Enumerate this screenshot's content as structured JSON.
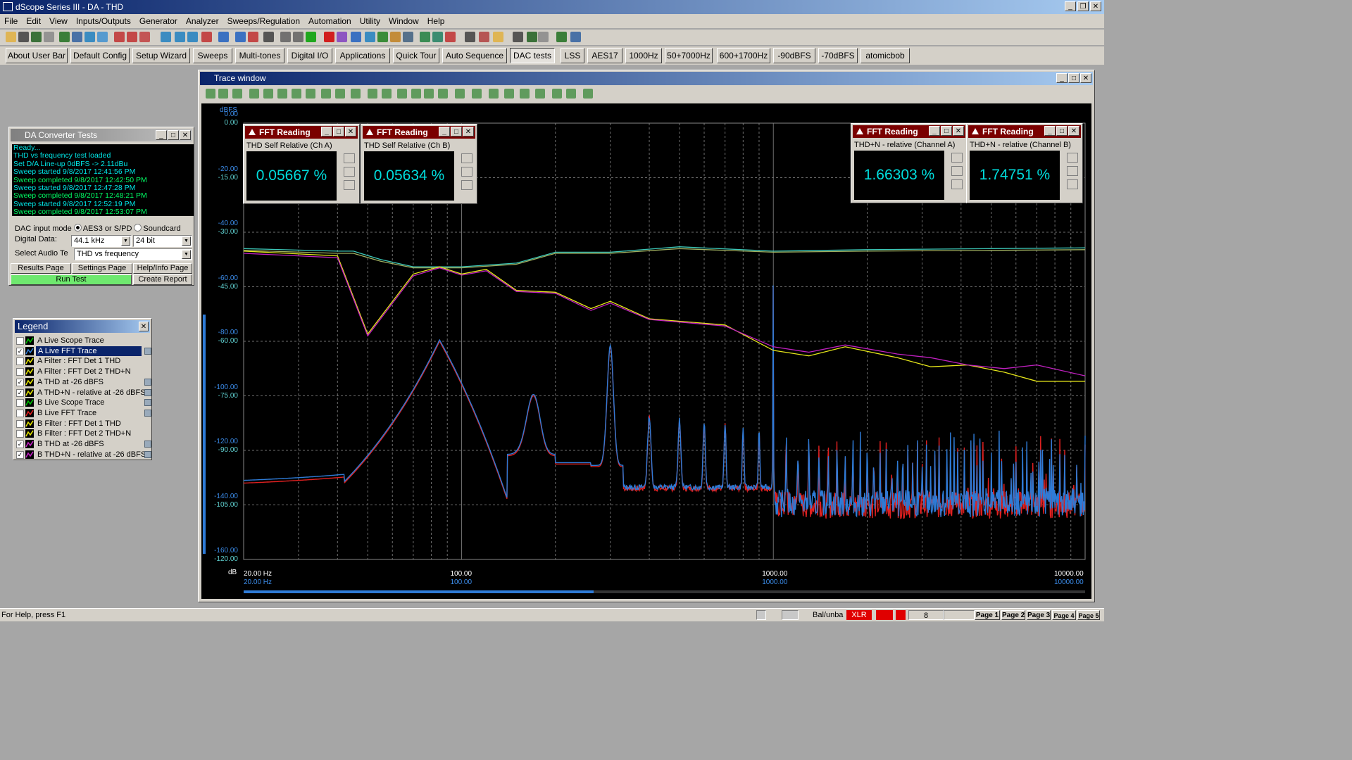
{
  "app": {
    "title": "dScope Series III - DA - THD"
  },
  "menu": [
    "File",
    "Edit",
    "View",
    "Inputs/Outputs",
    "Generator",
    "Analyzer",
    "Sweeps/Regulation",
    "Automation",
    "Utility",
    "Window",
    "Help"
  ],
  "user_bar": [
    "About User Bar",
    "Default Config",
    "Setup Wizard",
    "Sweeps",
    "Multi-tones",
    "Digital I/O",
    "Applications",
    "Quick Tour",
    "Auto Sequence",
    "DAC tests",
    "LSS",
    "AES17",
    "1000Hz",
    "50+7000Hz",
    "600+1700Hz",
    "-90dBFS",
    "-70dBFS",
    "atomicbob"
  ],
  "user_bar_pressed": "DAC tests",
  "dac_panel": {
    "title": "DA Converter Tests",
    "log": [
      {
        "text": "Ready...",
        "color": "cyan"
      },
      {
        "text": "THD vs frequency test loaded",
        "color": "cyan"
      },
      {
        "text": "Set D/A Line-up 0dBFS -> 2.11dBu",
        "color": "cyan"
      },
      {
        "text": "Sweep started 9/8/2017 12:41:56 PM",
        "color": "cyan"
      },
      {
        "text": "Sweep completed 9/8/2017 12:42:50 PM",
        "color": "green"
      },
      {
        "text": "Sweep started 9/8/2017 12:47:28 PM",
        "color": "cyan"
      },
      {
        "text": "Sweep completed 9/8/2017 12:48:21 PM",
        "color": "green"
      },
      {
        "text": "Sweep started 9/8/2017 12:52:19 PM",
        "color": "cyan"
      },
      {
        "text": "Sweep completed 9/8/2017 12:53:07 PM",
        "color": "green"
      }
    ],
    "input_mode_label": "DAC input mode",
    "input_mode_options": [
      "AES3 or S/PD",
      "Soundcard"
    ],
    "digital_data_label": "Digital Data:",
    "sample_rate": "44.1 kHz",
    "bit_depth": "24 bit",
    "select_label": "Select Audio Te",
    "selected_test": "THD vs frequency",
    "buttons": {
      "results": "Results Page",
      "settings": "Settings Page",
      "help": "Help/Info Page",
      "run": "Run Test",
      "report": "Create Report"
    }
  },
  "legend": {
    "title": "Legend",
    "items": [
      {
        "label": "A Live Scope Trace",
        "checked": false,
        "swatch": "#00c000",
        "icon": false
      },
      {
        "label": "A Live FFT Trace",
        "checked": true,
        "swatch": "#2e7bd6",
        "icon": true,
        "selected": true
      },
      {
        "label": "A Filter : FFT Det 1 THD",
        "checked": false,
        "swatch": "#e0e000",
        "icon": false
      },
      {
        "label": "A Filter : FFT Det 2  THD+N",
        "checked": false,
        "swatch": "#e0e000",
        "icon": false
      },
      {
        "label": "A THD  at -26 dBFS",
        "checked": true,
        "swatch": "#e0e000",
        "icon": true
      },
      {
        "label": "A THD+N - relative  at -26 dBFS",
        "checked": true,
        "swatch": "#e0e000",
        "icon": true
      },
      {
        "label": "B Live Scope Trace",
        "checked": false,
        "swatch": "#00c000",
        "icon": true
      },
      {
        "label": "B Live FFT Trace",
        "checked": false,
        "swatch": "#e02020",
        "icon": true
      },
      {
        "label": "B Filter : FFT Det 1 THD",
        "checked": false,
        "swatch": "#e0e000",
        "icon": false
      },
      {
        "label": "B Filter : FFT Det 2 THD+N",
        "checked": false,
        "swatch": "#e0e000",
        "icon": false
      },
      {
        "label": "B THD  at -26 dBFS",
        "checked": true,
        "swatch": "#c020c0",
        "icon": true
      },
      {
        "label": "B THD+N - relative  at -26 dBFS",
        "checked": true,
        "swatch": "#c020c0",
        "icon": true
      }
    ]
  },
  "trace_window": {
    "title": "Trace window"
  },
  "fft_readings": [
    {
      "title": "FFT Reading",
      "label": "THD Self Relative (Ch A)",
      "value": "0.05667 %"
    },
    {
      "title": "FFT Reading",
      "label": "THD Self Relative (Ch B)",
      "value": "0.05634 %"
    },
    {
      "title": "FFT Reading",
      "label": "THD+N - relative (Channel A)",
      "value": "1.66303 %"
    },
    {
      "title": "FFT Reading",
      "label": "THD+N - relative (Channel B)",
      "value": "1.74751 %"
    }
  ],
  "chart_data": {
    "type": "line",
    "x_scale": "log",
    "xlim": [
      20,
      10000
    ],
    "left_axis_outer": {
      "unit": "dBFS",
      "range": [
        -160,
        0
      ],
      "ticks": [
        "0.00",
        "-20.00",
        "-40.00",
        "-60.00",
        "-80.00",
        "-100.00",
        "-120.00",
        "-140.00",
        "-160.00"
      ]
    },
    "left_axis_inner": {
      "unit": "dB",
      "range": [
        -120,
        0
      ],
      "ticks": [
        "0.00",
        "-15.00",
        "-30.00",
        "-45.00",
        "-60.00",
        "-75.00",
        "-90.00",
        "-105.00",
        "-120.00"
      ]
    },
    "x_ticks": [
      "20.00 Hz",
      "100.00",
      "1000.00",
      "10000.00"
    ],
    "series": [
      {
        "name": "A THD+N - relative  at -26 dBFS",
        "color": "#3cc8b8",
        "axis": "dB",
        "x": [
          20,
          40,
          45,
          55,
          70,
          100,
          150,
          200,
          300,
          500,
          1000,
          2000,
          5000,
          10000
        ],
        "y": [
          -34.5,
          -35.2,
          -35.2,
          -37.5,
          -39.5,
          -39.5,
          -38.5,
          -35.5,
          -35.5,
          -34.0,
          -35.2,
          -34.8,
          -34.5,
          -34.3
        ]
      },
      {
        "name": "B THD+N - relative  at -26 dBFS",
        "color": "#a0b060",
        "axis": "dB",
        "x": [
          20,
          40,
          45,
          55,
          70,
          100,
          150,
          200,
          300,
          500,
          1000,
          2000,
          5000,
          10000
        ],
        "y": [
          -35.0,
          -35.8,
          -35.8,
          -38.0,
          -39.8,
          -39.8,
          -38.8,
          -35.8,
          -35.8,
          -34.5,
          -35.5,
          -35.2,
          -35.0,
          -34.8
        ]
      },
      {
        "name": "A THD  at -26 dBFS",
        "color": "#e6e61a",
        "axis": "dB",
        "x": [
          20,
          40,
          50,
          70,
          85,
          100,
          120,
          150,
          200,
          260,
          300,
          400,
          700,
          1000,
          1300,
          1700,
          2500,
          3200,
          4200,
          5500,
          7000,
          10000
        ],
        "y": [
          -35.2,
          -36.5,
          -58.0,
          -41.5,
          -39.5,
          -41.5,
          -40.2,
          -46.0,
          -46.5,
          -51.0,
          -49.0,
          -53.8,
          -55.5,
          -62.5,
          -64.0,
          -61.5,
          -64.5,
          -67.0,
          -66.5,
          -68.5,
          -71.0,
          -71.0
        ]
      },
      {
        "name": "B THD  at -26 dBFS",
        "color": "#c020c0",
        "axis": "dB",
        "x": [
          20,
          40,
          50,
          70,
          85,
          100,
          120,
          150,
          200,
          260,
          300,
          400,
          700,
          1000,
          1300,
          1700,
          2500,
          3200,
          4200,
          5500,
          7000,
          10000
        ],
        "y": [
          -35.8,
          -37.0,
          -58.5,
          -42.0,
          -39.8,
          -41.8,
          -40.6,
          -46.3,
          -46.8,
          -51.5,
          -49.5,
          -54.0,
          -55.8,
          -61.5,
          -63.0,
          -61.0,
          -63.5,
          -64.5,
          -66.5,
          -67.5,
          -66.5,
          -69.5
        ]
      }
    ]
  },
  "statusbar": {
    "help": "For Help, press F1",
    "items": [
      "Bal/unba",
      "XLR",
      "8"
    ],
    "pages": [
      "Page 1",
      "Page 2",
      "Page 3",
      "Page 4",
      "Page 5"
    ]
  },
  "colors": {
    "plot_bg": "#000000",
    "grid": "#6e6e6e",
    "fft_a": "#2e7bd6",
    "fft_b": "#e02020",
    "run_button": "#6fe86f"
  }
}
